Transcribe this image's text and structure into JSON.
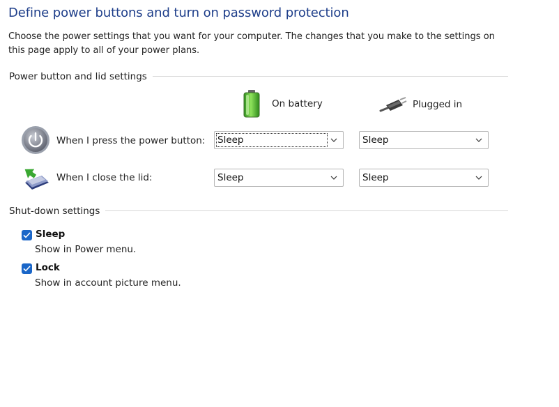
{
  "page": {
    "title": "Define power buttons and turn on password protection",
    "intro": "Choose the power settings that you want for your computer. The changes that you make to the settings on this page apply to all of your power plans."
  },
  "power_section": {
    "header": "Power button and lid settings",
    "columns": {
      "battery": {
        "label": "On battery",
        "icon": "battery-icon"
      },
      "plugged": {
        "label": "Plugged in",
        "icon": "power-plug-icon"
      }
    },
    "rows": [
      {
        "label": "When I press the power button:",
        "icon": "power-button-icon",
        "battery": "Sleep",
        "plugged": "Sleep"
      },
      {
        "label": "When I close the lid:",
        "icon": "laptop-lid-icon",
        "battery": "Sleep",
        "plugged": "Sleep"
      }
    ]
  },
  "shutdown_section": {
    "header": "Shut-down settings",
    "options": [
      {
        "title": "Sleep",
        "description": "Show in Power menu.",
        "checked": true
      },
      {
        "title": "Lock",
        "description": "Show in account picture menu.",
        "checked": true
      }
    ]
  },
  "colors": {
    "title": "#1e3e8a",
    "checkbox": "#1a66c8",
    "divider": "#d6d6d6"
  }
}
